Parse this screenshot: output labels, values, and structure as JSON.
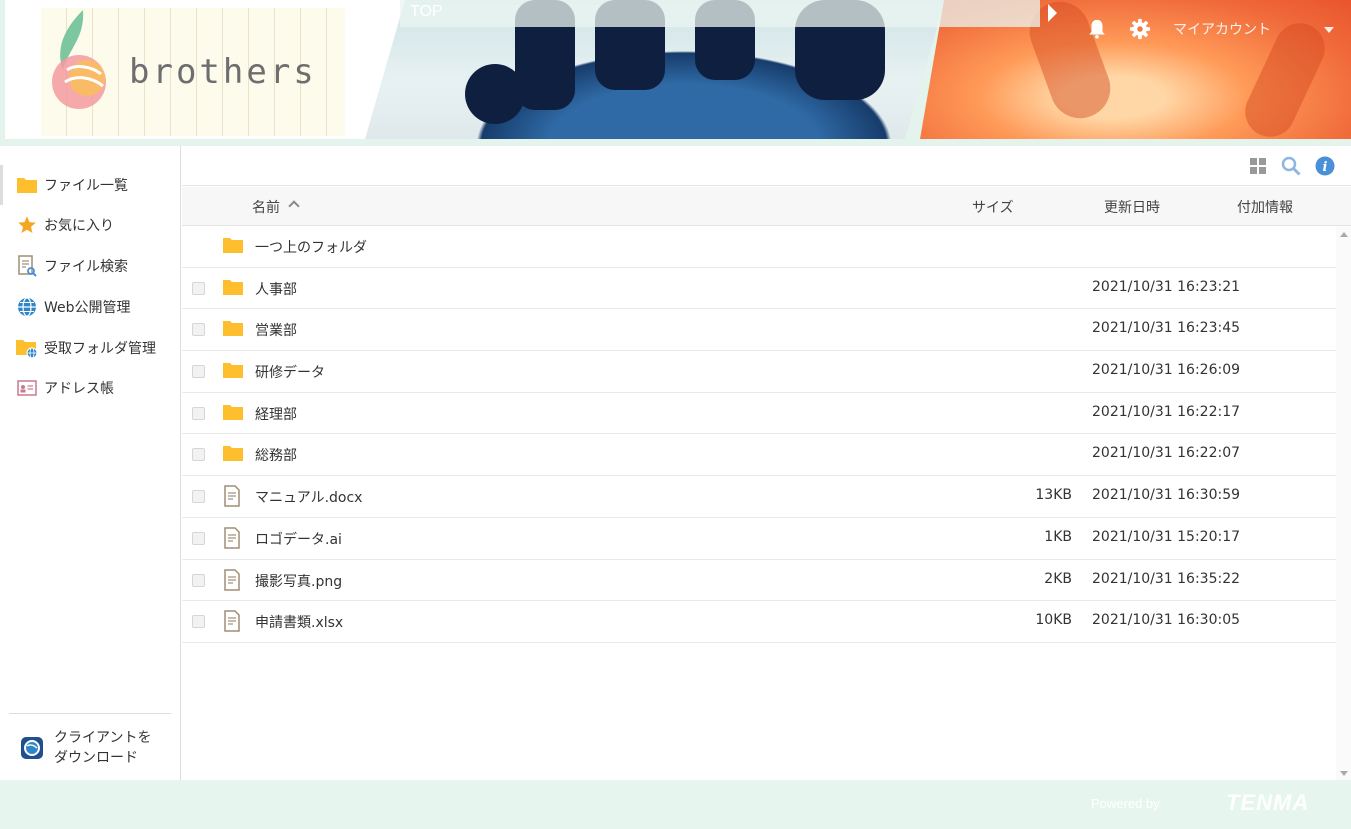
{
  "header": {
    "brand": "brothers",
    "breadcrumb": "TOP",
    "account_label": "マイアカウント"
  },
  "sidebar": {
    "items": [
      {
        "label": "ファイル一覧",
        "icon": "folder-icon"
      },
      {
        "label": "お気に入り",
        "icon": "star-icon"
      },
      {
        "label": "ファイル検索",
        "icon": "file-search-icon"
      },
      {
        "label": "Web公開管理",
        "icon": "globe-icon"
      },
      {
        "label": "受取フォルダ管理",
        "icon": "receive-folder-icon"
      },
      {
        "label": "アドレス帳",
        "icon": "address-book-icon"
      }
    ],
    "client_download": {
      "line1": "クライアントを",
      "line2": "ダウンロード"
    }
  },
  "columns": {
    "name": "名前",
    "size": "サイズ",
    "modified": "更新日時",
    "extra": "付加情報"
  },
  "rows": [
    {
      "type": "parent",
      "name": "一つ上のフォルダ",
      "size": "",
      "date": ""
    },
    {
      "type": "folder",
      "name": "人事部",
      "size": "",
      "date": "2021/10/31 16:23:21"
    },
    {
      "type": "folder",
      "name": "営業部",
      "size": "",
      "date": "2021/10/31 16:23:45"
    },
    {
      "type": "folder",
      "name": "研修データ",
      "size": "",
      "date": "2021/10/31 16:26:09"
    },
    {
      "type": "folder",
      "name": "経理部",
      "size": "",
      "date": "2021/10/31 16:22:17"
    },
    {
      "type": "folder",
      "name": "総務部",
      "size": "",
      "date": "2021/10/31 16:22:07"
    },
    {
      "type": "file",
      "name": "マニュアル.docx",
      "size": "13KB",
      "date": "2021/10/31 16:30:59"
    },
    {
      "type": "file",
      "name": "ロゴデータ.ai",
      "size": "1KB",
      "date": "2021/10/31 15:20:17"
    },
    {
      "type": "file",
      "name": "撮影写真.png",
      "size": "2KB",
      "date": "2021/10/31 16:35:22"
    },
    {
      "type": "file",
      "name": "申請書類.xlsx",
      "size": "10KB",
      "date": "2021/10/31 16:30:05"
    }
  ],
  "footer": {
    "powered_by": "Powered by",
    "vendor": "TENMA"
  },
  "colors": {
    "folder": "#FDBF2D",
    "accent_blue": "#4A90D9",
    "footer_bg": "#E6F6EE"
  }
}
